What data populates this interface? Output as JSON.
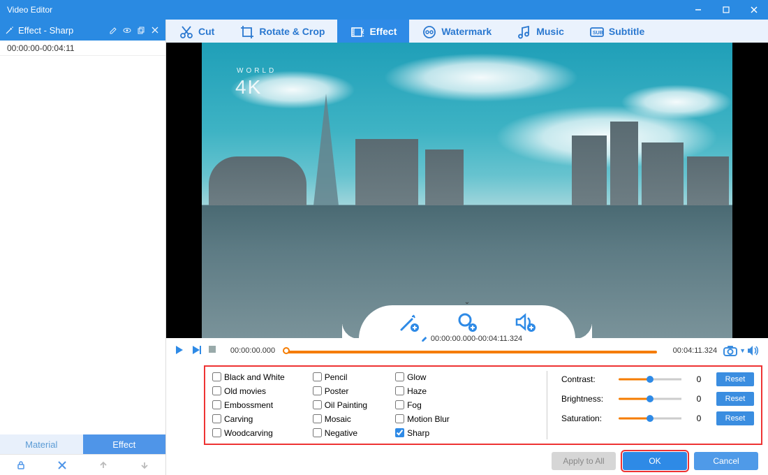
{
  "window": {
    "title": "Video Editor"
  },
  "sidebar": {
    "title_prefix": "Effect - ",
    "title_value": "Sharp",
    "clip_time": "00:00:00-00:04:11",
    "tabs": {
      "material": "Material",
      "effect": "Effect"
    }
  },
  "toptabs": {
    "cut": "Cut",
    "rotate": "Rotate & Crop",
    "effect": "Effect",
    "watermark": "Watermark",
    "music": "Music",
    "subtitle": "Subtitle"
  },
  "preview": {
    "watermark_small": "WORLD",
    "watermark_big": "4K"
  },
  "timeline": {
    "start": "00:00:00.000",
    "range": "00:00:00.000-00:04:11.324",
    "end": "00:04:11.324"
  },
  "effects": {
    "col1": [
      "Black and White",
      "Old movies",
      "Embossment",
      "Carving",
      "Woodcarving"
    ],
    "col2": [
      "Pencil",
      "Poster",
      "Oil Painting",
      "Mosaic",
      "Negative"
    ],
    "col3": [
      "Glow",
      "Haze",
      "Fog",
      "Motion Blur",
      "Sharp"
    ],
    "checked": "Sharp"
  },
  "adjust": {
    "rows": [
      {
        "label": "Contrast:",
        "value": "0"
      },
      {
        "label": "Brightness:",
        "value": "0"
      },
      {
        "label": "Saturation:",
        "value": "0"
      }
    ],
    "reset": "Reset"
  },
  "footer": {
    "apply": "Apply to All",
    "ok": "OK",
    "cancel": "Cancel"
  }
}
